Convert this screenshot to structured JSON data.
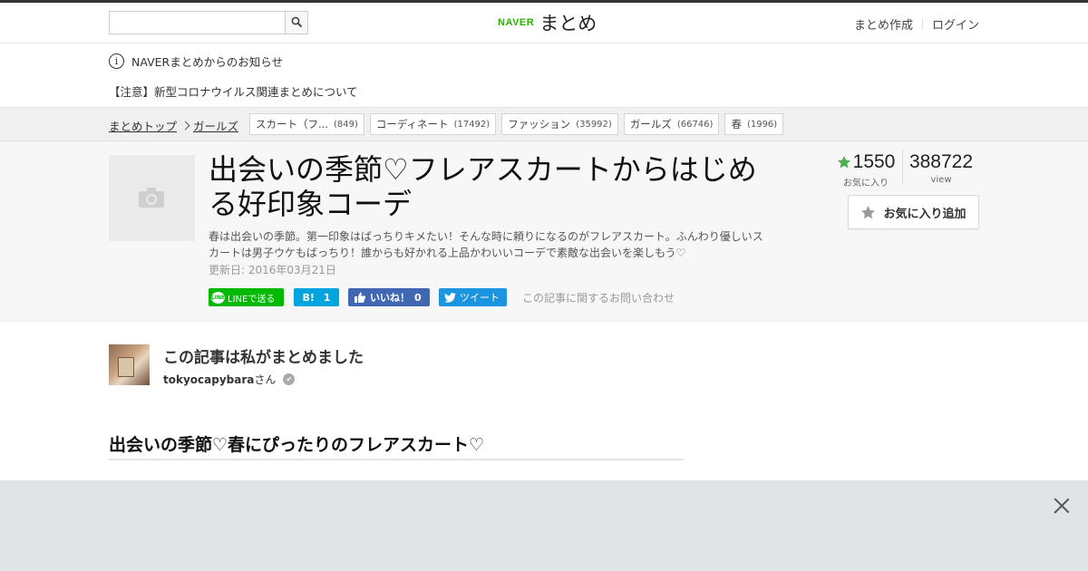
{
  "header": {
    "search_placeholder": "",
    "logo_brand": "NAVER",
    "logo_title": "まとめ",
    "create_link": "まとめ作成",
    "login_link": "ログイン"
  },
  "notice": {
    "info_text": "NAVERまとめからのお知らせ",
    "link_text": "【注意】新型コロナウイルス関連まとめについて"
  },
  "breadcrumb": {
    "items": [
      "まとめトップ",
      "ガールズ"
    ]
  },
  "tags": [
    {
      "label": "スカート（フ...",
      "count": "(849)"
    },
    {
      "label": "コーディネート",
      "count": "(17492)"
    },
    {
      "label": "ファッション",
      "count": "(35992)"
    },
    {
      "label": "ガールズ",
      "count": "(66746)"
    },
    {
      "label": "春",
      "count": "(1996)"
    }
  ],
  "article": {
    "title": "出会いの季節♡フレアスカートからはじめる好印象コーデ",
    "description": "春は出会いの季節。第一印象はばっちりキメたい！そんな時に頼りになるのがフレアスカート。ふんわり優しいスカートは男子ウケもばっちり！誰からも好かれる上品かわいいコーデで素敵な出会いを楽しもう♡",
    "updated": "更新日: 2016年03月21日",
    "favorites_count": "1550",
    "favorites_label": "お気に入り",
    "view_count": "388722",
    "view_label": "view",
    "fav_button_label": "お気に入り追加"
  },
  "share": {
    "line_label": "LINEで送る",
    "hatena_label": "B!",
    "hatena_count": "1",
    "fb_label": "いいね！",
    "fb_count": "0",
    "tweet_label": "ツイート",
    "inquiry_label": "この記事に関するお問い合わせ"
  },
  "author": {
    "heading": "この記事は私がまとめました",
    "name": "tokyocapybara",
    "suffix": "さん"
  },
  "section": {
    "title": "出会いの季節♡春にぴったりのフレアスカート♡"
  },
  "colors": {
    "naver_green": "#2db400",
    "line_green": "#00b900",
    "hatena_blue": "#00a4de",
    "facebook_blue": "#4267b2",
    "twitter_blue": "#1b95e0",
    "star_green": "#4caf50"
  }
}
